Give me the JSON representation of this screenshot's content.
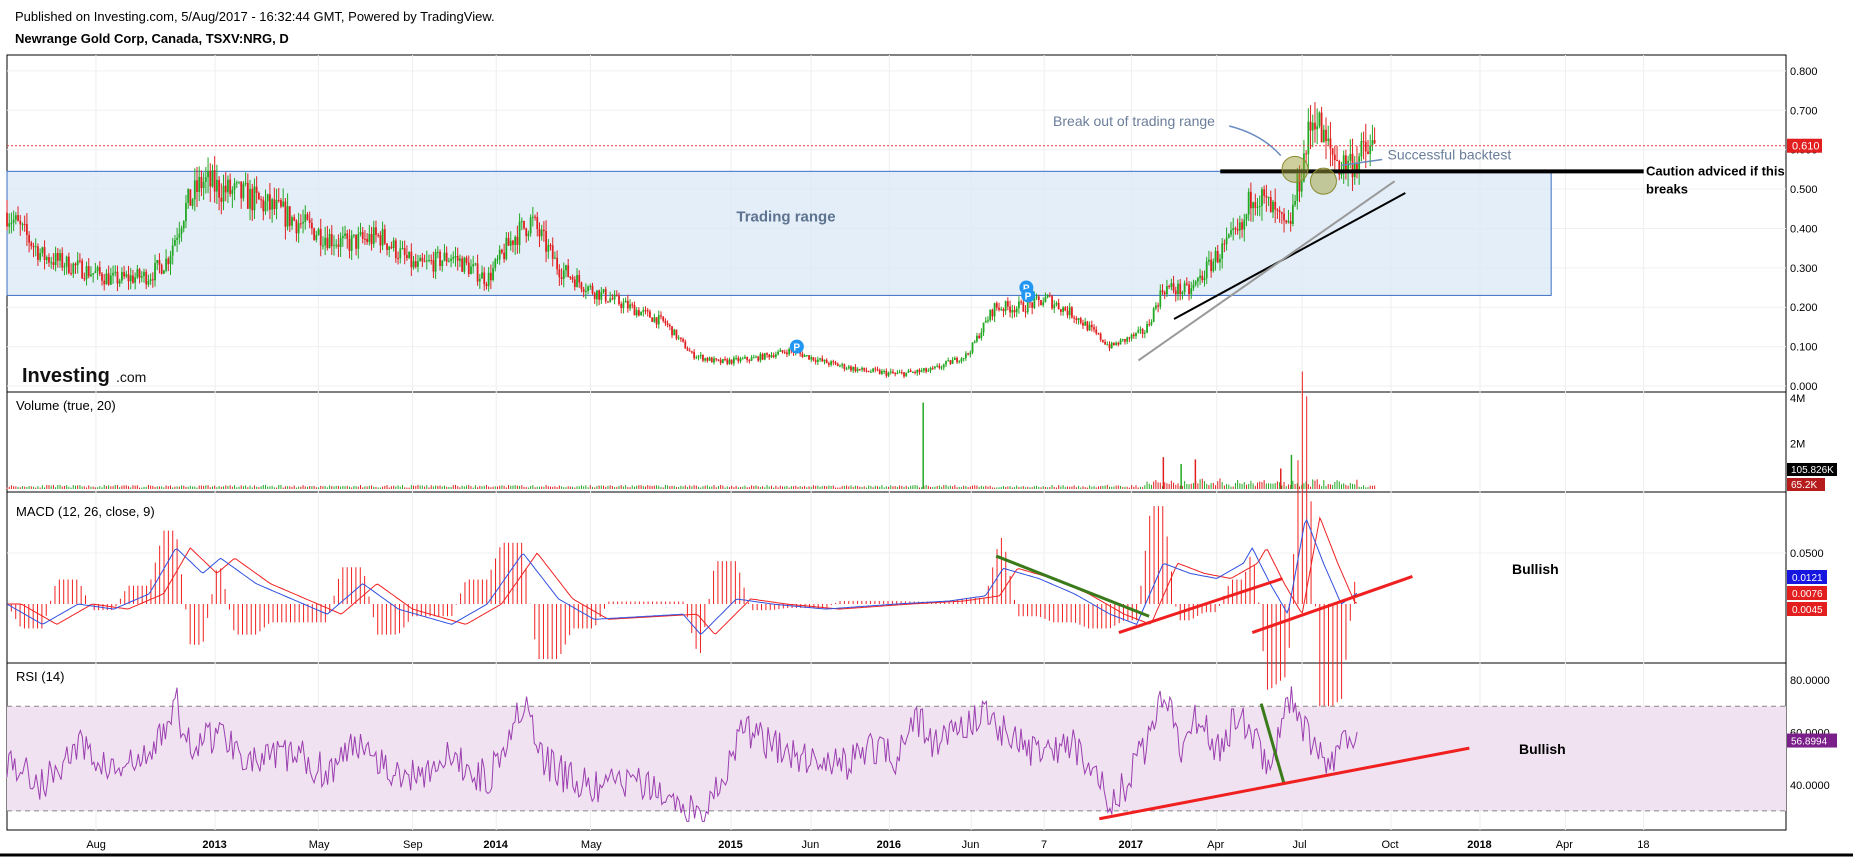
{
  "header": {
    "published": "Published on Investing.com, 5/Aug/2017 - 16:32:44 GMT, Powered by TradingView.",
    "symbol": "Newrange Gold Corp, Canada, TSXV:NRG, D"
  },
  "watermark": "Investing",
  "watermark_suffix": ".com",
  "colors": {
    "up": "#22a822",
    "down": "#e02020",
    "range_fill": "#dbe8f6",
    "range_stroke": "#3a6fc4",
    "macd": "#3050e0",
    "signal": "#f02020",
    "rsi": "#9b3fb0",
    "rsi_band": "#f1e2f1",
    "annotation_text": "#6a7d9a",
    "marker": "#2196f3"
  },
  "chart_data": [
    {
      "type": "candlestick",
      "name": "price",
      "title": "Newrange Gold Corp, Canada, TSXV:NRG, D",
      "ylim": [
        0,
        0.82
      ],
      "y_ticks": [
        "0.800",
        "0.700",
        "0.600",
        "0.500",
        "0.400",
        "0.300",
        "0.200",
        "0.100",
        "0.000"
      ],
      "last_value_label": "0.610",
      "last_value": 0.61,
      "x_labels": [
        "Aug",
        "2013",
        "May",
        "Sep",
        "2014",
        "May",
        "2015",
        "Jun",
        "2016",
        "Jun",
        "7",
        "2017",
        "Apr",
        "Jul",
        "Oct",
        "2018",
        "Apr",
        "18"
      ],
      "x_label_frac": [
        0.05,
        0.117,
        0.175,
        0.228,
        0.275,
        0.328,
        0.407,
        0.452,
        0.496,
        0.542,
        0.583,
        0.632,
        0.68,
        0.728,
        0.778,
        0.828,
        0.876,
        0.92
      ],
      "series_close_points": [
        [
          0.0,
          0.44
        ],
        [
          0.02,
          0.33
        ],
        [
          0.04,
          0.3
        ],
        [
          0.06,
          0.27
        ],
        [
          0.08,
          0.28
        ],
        [
          0.09,
          0.32
        ],
        [
          0.1,
          0.45
        ],
        [
          0.11,
          0.52
        ],
        [
          0.12,
          0.5
        ],
        [
          0.135,
          0.48
        ],
        [
          0.15,
          0.45
        ],
        [
          0.17,
          0.4
        ],
        [
          0.19,
          0.36
        ],
        [
          0.21,
          0.38
        ],
        [
          0.23,
          0.3
        ],
        [
          0.25,
          0.33
        ],
        [
          0.27,
          0.27
        ],
        [
          0.285,
          0.38
        ],
        [
          0.295,
          0.42
        ],
        [
          0.31,
          0.3
        ],
        [
          0.33,
          0.24
        ],
        [
          0.35,
          0.2
        ],
        [
          0.37,
          0.16
        ],
        [
          0.385,
          0.08
        ],
        [
          0.4,
          0.06
        ],
        [
          0.42,
          0.07
        ],
        [
          0.44,
          0.09
        ],
        [
          0.46,
          0.06
        ],
        [
          0.48,
          0.04
        ],
        [
          0.5,
          0.03
        ],
        [
          0.52,
          0.04
        ],
        [
          0.54,
          0.08
        ],
        [
          0.555,
          0.2
        ],
        [
          0.57,
          0.2
        ],
        [
          0.585,
          0.22
        ],
        [
          0.6,
          0.18
        ],
        [
          0.62,
          0.1
        ],
        [
          0.64,
          0.14
        ],
        [
          0.65,
          0.25
        ],
        [
          0.665,
          0.24
        ],
        [
          0.68,
          0.33
        ],
        [
          0.695,
          0.4
        ],
        [
          0.7,
          0.5
        ],
        [
          0.71,
          0.45
        ],
        [
          0.72,
          0.39
        ],
        [
          0.73,
          0.6
        ],
        [
          0.735,
          0.7
        ],
        [
          0.74,
          0.62
        ],
        [
          0.75,
          0.56
        ],
        [
          0.76,
          0.58
        ],
        [
          0.77,
          0.61
        ]
      ],
      "trading_range": {
        "label": "Trading range",
        "low": 0.23,
        "high": 0.545,
        "x_start": 0.0,
        "x_end": 0.868
      },
      "horizontal_level": {
        "value": 0.545,
        "x_start": 0.682,
        "x_end": 0.92,
        "label": "Caution adviced if this breaks"
      },
      "trendlines": [
        {
          "from": [
            0.656,
            0.17
          ],
          "to": [
            0.786,
            0.49
          ],
          "color": "#000"
        },
        {
          "from": [
            0.636,
            0.065
          ],
          "to": [
            0.78,
            0.52
          ],
          "color": "#999"
        }
      ],
      "annotations": [
        {
          "text": "Break out of trading range",
          "at": [
            0.588,
            0.66
          ]
        },
        {
          "text": "Successful backtest",
          "at": [
            0.776,
            0.575
          ]
        }
      ],
      "circles": [
        [
          0.724,
          0.55
        ],
        [
          0.74,
          0.52
        ]
      ],
      "markers": [
        [
          0.444,
          0.1
        ],
        [
          0.573,
          0.25
        ],
        [
          0.574,
          0.23
        ]
      ]
    },
    {
      "type": "bar",
      "name": "volume",
      "title": "Volume (true, 20)",
      "y_ticks": [
        "4M",
        "2M"
      ],
      "ylim": [
        0,
        4000000
      ],
      "last_value_labels": [
        "105.826K",
        "65.2K"
      ],
      "spikes": [
        {
          "x": 0.515,
          "value": 3800000,
          "color": "up"
        },
        {
          "x": 0.65,
          "value": 1400000,
          "color": "down"
        },
        {
          "x": 0.66,
          "value": 1100000,
          "color": "up"
        },
        {
          "x": 0.668,
          "value": 1300000,
          "color": "down"
        },
        {
          "x": 0.722,
          "value": 1500000,
          "color": "up"
        },
        {
          "x": 0.716,
          "value": 900000,
          "color": "down"
        }
      ]
    },
    {
      "type": "line",
      "name": "macd",
      "title": "MACD (12, 26, close, 9)",
      "y_ticks": [
        "0.0500"
      ],
      "ylim": [
        -0.05,
        0.1
      ],
      "last_value_labels": [
        "0.0121",
        "0.0076",
        "0.0045"
      ],
      "annotation": "Bullish",
      "series_points": [
        [
          0.0,
          0.0
        ],
        [
          0.02,
          -0.02
        ],
        [
          0.04,
          0.0
        ],
        [
          0.06,
          -0.005
        ],
        [
          0.08,
          0.01
        ],
        [
          0.095,
          0.055
        ],
        [
          0.11,
          0.03
        ],
        [
          0.12,
          0.045
        ],
        [
          0.14,
          0.02
        ],
        [
          0.16,
          0.005
        ],
        [
          0.18,
          -0.01
        ],
        [
          0.2,
          0.02
        ],
        [
          0.22,
          -0.005
        ],
        [
          0.25,
          -0.02
        ],
        [
          0.27,
          0.0
        ],
        [
          0.29,
          0.05
        ],
        [
          0.31,
          0.005
        ],
        [
          0.33,
          -0.015
        ],
        [
          0.36,
          -0.012
        ],
        [
          0.38,
          -0.01
        ],
        [
          0.39,
          -0.03
        ],
        [
          0.41,
          0.005
        ],
        [
          0.43,
          0.0
        ],
        [
          0.46,
          -0.005
        ],
        [
          0.5,
          0.0
        ],
        [
          0.53,
          0.003
        ],
        [
          0.55,
          0.008
        ],
        [
          0.56,
          0.035
        ],
        [
          0.58,
          0.025
        ],
        [
          0.6,
          0.01
        ],
        [
          0.62,
          -0.01
        ],
        [
          0.635,
          -0.02
        ],
        [
          0.65,
          0.04
        ],
        [
          0.665,
          0.03
        ],
        [
          0.68,
          0.025
        ],
        [
          0.695,
          0.04
        ],
        [
          0.7,
          0.055
        ],
        [
          0.71,
          0.02
        ],
        [
          0.72,
          -0.01
        ],
        [
          0.73,
          0.085
        ],
        [
          0.74,
          0.04
        ],
        [
          0.75,
          0.0
        ],
        [
          0.76,
          0.012
        ]
      ],
      "trendlines": [
        {
          "from": [
            0.556,
            0.047
          ],
          "to": [
            0.642,
            -0.012
          ],
          "color": "#3a7a1a"
        },
        {
          "from": [
            0.625,
            -0.028
          ],
          "to": [
            0.717,
            0.025
          ],
          "color": "#f02020"
        },
        {
          "from": [
            0.7,
            -0.028
          ],
          "to": [
            0.79,
            0.027
          ],
          "color": "#f02020"
        }
      ]
    },
    {
      "type": "line",
      "name": "rsi",
      "title": "RSI (14)",
      "y_ticks": [
        "80.0000",
        "60.0000",
        "40.0000"
      ],
      "ylim": [
        25,
        85
      ],
      "bands": [
        30,
        70
      ],
      "last_value_label": "56.8994",
      "last_value": 56.8994,
      "annotation": "Bullish",
      "series_points": [
        [
          0.0,
          50
        ],
        [
          0.02,
          40
        ],
        [
          0.04,
          55
        ],
        [
          0.06,
          45
        ],
        [
          0.08,
          50
        ],
        [
          0.095,
          72
        ],
        [
          0.1,
          55
        ],
        [
          0.12,
          60
        ],
        [
          0.14,
          48
        ],
        [
          0.16,
          52
        ],
        [
          0.18,
          45
        ],
        [
          0.2,
          58
        ],
        [
          0.22,
          42
        ],
        [
          0.25,
          50
        ],
        [
          0.27,
          42
        ],
        [
          0.29,
          72
        ],
        [
          0.3,
          50
        ],
        [
          0.31,
          45
        ],
        [
          0.33,
          38
        ],
        [
          0.35,
          42
        ],
        [
          0.37,
          35
        ],
        [
          0.39,
          28
        ],
        [
          0.4,
          40
        ],
        [
          0.415,
          62
        ],
        [
          0.43,
          55
        ],
        [
          0.45,
          50
        ],
        [
          0.47,
          48
        ],
        [
          0.49,
          55
        ],
        [
          0.5,
          50
        ],
        [
          0.51,
          68
        ],
        [
          0.52,
          55
        ],
        [
          0.55,
          68
        ],
        [
          0.56,
          60
        ],
        [
          0.58,
          52
        ],
        [
          0.6,
          55
        ],
        [
          0.615,
          45
        ],
        [
          0.62,
          30
        ],
        [
          0.63,
          42
        ],
        [
          0.64,
          55
        ],
        [
          0.65,
          78
        ],
        [
          0.66,
          55
        ],
        [
          0.67,
          68
        ],
        [
          0.68,
          52
        ],
        [
          0.69,
          65
        ],
        [
          0.7,
          60
        ],
        [
          0.71,
          45
        ],
        [
          0.72,
          74
        ],
        [
          0.73,
          60
        ],
        [
          0.74,
          48
        ],
        [
          0.75,
          55
        ],
        [
          0.76,
          57
        ]
      ],
      "trendlines": [
        {
          "from": [
            0.705,
            71
          ],
          "to": [
            0.718,
            40
          ],
          "color": "#3a7a1a"
        },
        {
          "from": [
            0.614,
            27
          ],
          "to": [
            0.822,
            54
          ],
          "color": "#f02020"
        }
      ]
    }
  ]
}
